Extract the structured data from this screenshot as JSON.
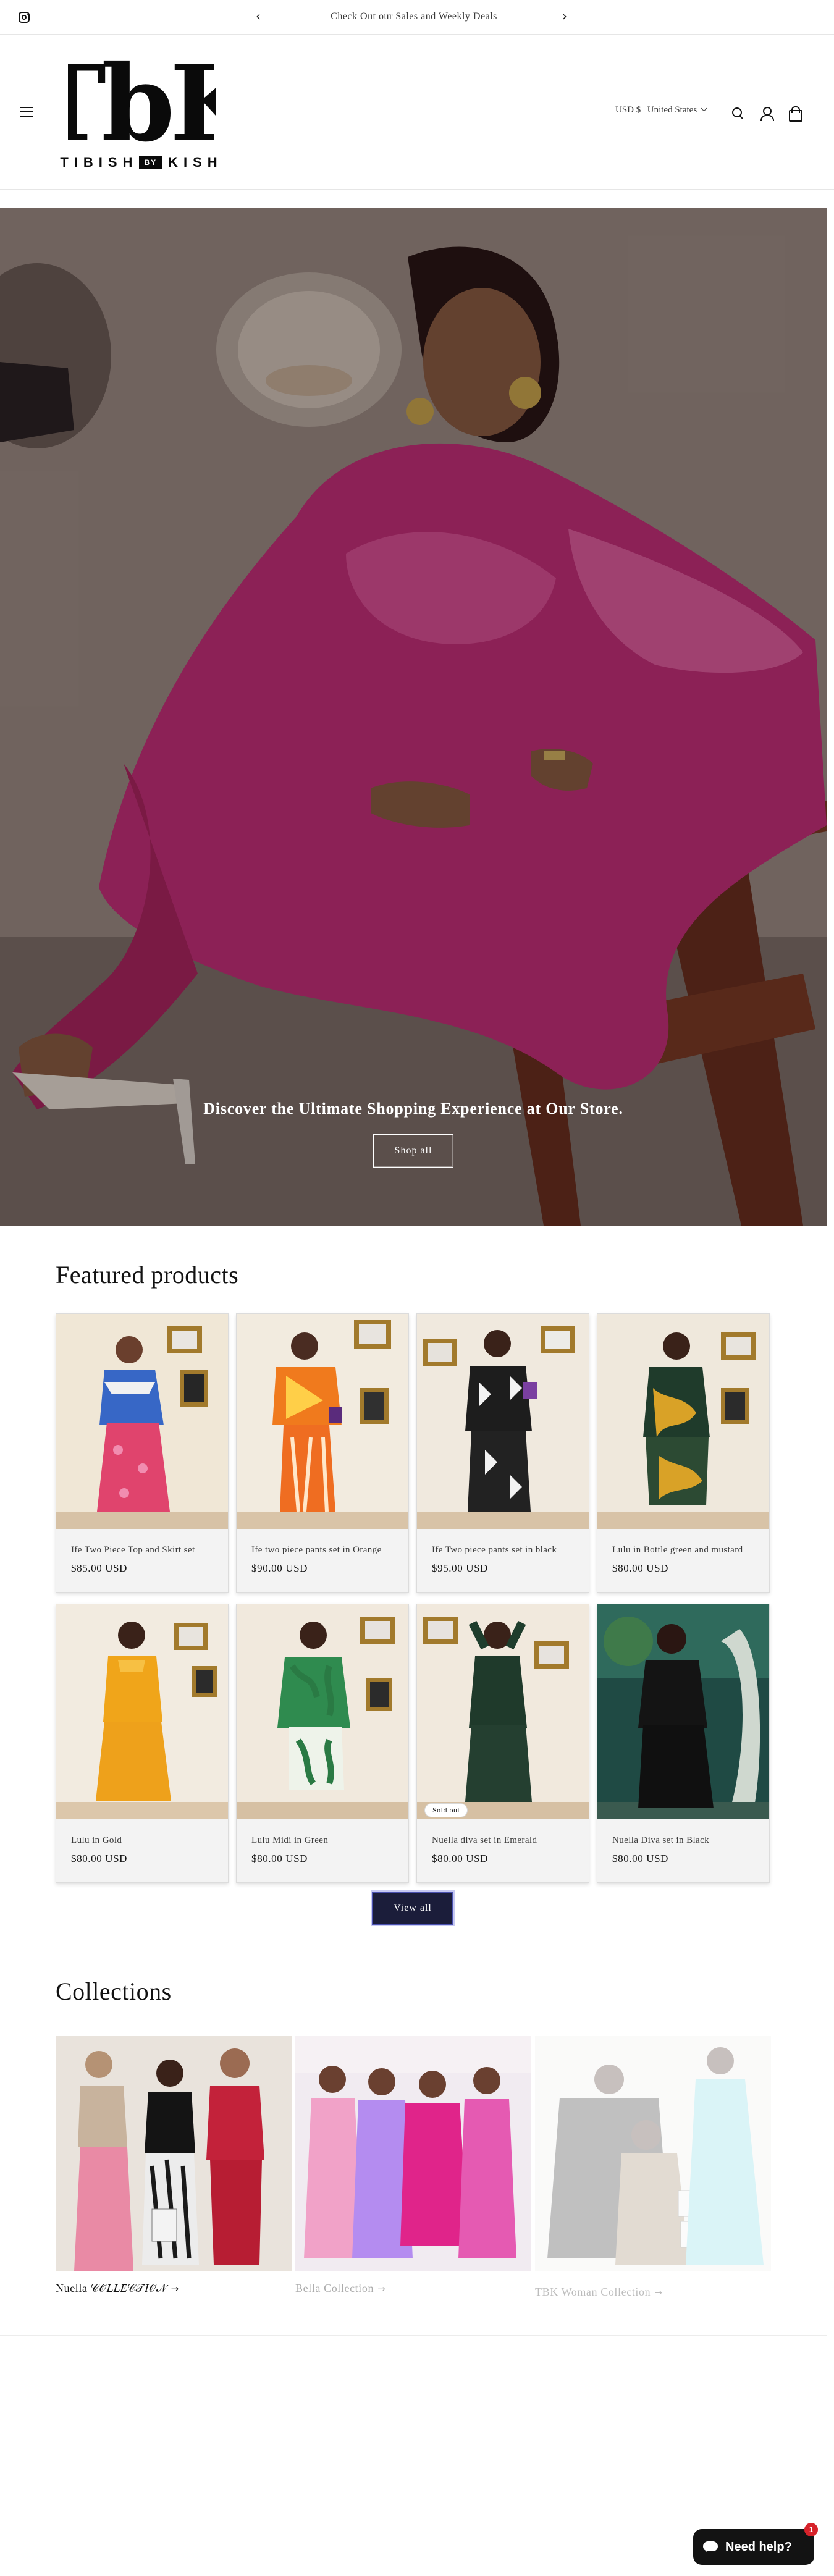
{
  "announcement": {
    "message": "Check Out our Sales and Weekly Deals",
    "prev": "‹",
    "next": "›"
  },
  "header": {
    "logo_mark": "TbK",
    "logo_brand_left": "TIBISH",
    "logo_brand_by": "BY",
    "logo_brand_right": "KISH",
    "locale": "USD $ | United States"
  },
  "hero": {
    "heading": "Discover the Ultimate Shopping Experience at Our Store.",
    "button": "Shop all"
  },
  "featured": {
    "title": "Featured products",
    "products": [
      {
        "title": "Ife Two Piece Top and Skirt set",
        "price": "$85.00 USD",
        "badge": ""
      },
      {
        "title": "Ife two piece pants set in Orange",
        "price": "$90.00 USD",
        "badge": ""
      },
      {
        "title": "Ife Two piece pants set in black",
        "price": "$95.00 USD",
        "badge": ""
      },
      {
        "title": "Lulu in Bottle green and mustard",
        "price": "$80.00 USD",
        "badge": ""
      },
      {
        "title": "Lulu in Gold",
        "price": "$80.00 USD",
        "badge": ""
      },
      {
        "title": "Lulu Midi in Green",
        "price": "$80.00 USD",
        "badge": ""
      },
      {
        "title": "Nuella diva set in Emerald",
        "price": "$80.00 USD",
        "badge": "Sold out"
      },
      {
        "title": "Nuella Diva set in Black",
        "price": "$80.00 USD",
        "badge": ""
      }
    ],
    "view_all": "View all"
  },
  "collections": {
    "title": "Collections",
    "items": [
      {
        "label": "Nuella 𝒞𝒪𝐿𝐿𝐸𝒞𝒯𝐼𝒪𝒩"
      },
      {
        "label": "Bella Collection"
      },
      {
        "label": "TBK Woman Collection"
      }
    ],
    "arrow": "→"
  },
  "chat": {
    "label": "Need help?",
    "count": "1"
  },
  "colors": {
    "accent_button": "#1b1d3a",
    "chat_bg": "#131313",
    "badge_red": "#d6222a"
  }
}
